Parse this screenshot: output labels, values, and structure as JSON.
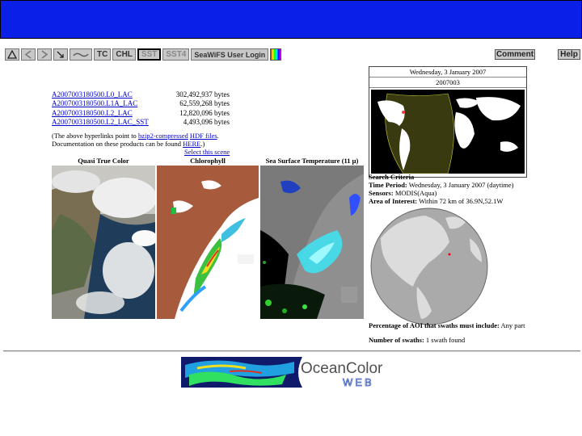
{
  "toolbar": {
    "buttons": [
      {
        "label": "TC"
      },
      {
        "label": "CHL"
      },
      {
        "label": "SST"
      },
      {
        "label": "SST4"
      },
      {
        "label": "SeaWiFS User Login"
      }
    ],
    "comment_label": "Comment",
    "help_label": "Help"
  },
  "files": [
    {
      "name": "A2007003180500.L0_LAC",
      "size": "302,492,937 bytes"
    },
    {
      "name": "A2007003180500.L1A_LAC",
      "size": "62,559,268 bytes"
    },
    {
      "name": "A2007003180500.L2_LAC",
      "size": "12,820,096 bytes"
    },
    {
      "name": "A2007003180500.L2_LAC_SST",
      "size": "4,493,096 bytes"
    }
  ],
  "note": {
    "line1_pre": "(The above hyperlinks point to ",
    "link1": "bzip2-compressed",
    "line1_mid": " ",
    "link2": "HDF files",
    "line1_post": ".",
    "line2_pre": "Documentation on these products can be found ",
    "link3": "HERE",
    "line2_post": ".)"
  },
  "select_scene": "Select this scene",
  "image_labels": {
    "true_color": "Quasi True Color",
    "chlorophyll": "Chlorophyll",
    "sst": "Sea Surface Temperature (11 μ)"
  },
  "date": {
    "long": "Wednesday, 3 January 2007",
    "short": "2007003"
  },
  "criteria": {
    "heading": "Search Criteria",
    "time_label": "Time Period:",
    "time_value": "Wednesday, 3 January 2007 (daytime)",
    "sensor_label": "Sensors:",
    "sensor_value": "MODIS(Aqua)",
    "area_label": "Area of Interest:",
    "area_value": "Within 72 km of 36.9N,52.1W"
  },
  "percentage": {
    "label": "Percentage of AOI that swaths must include:",
    "value": "Any part"
  },
  "swaths": {
    "label": "Number of swaths:",
    "value": "1 swath found"
  },
  "logo": {
    "line1": "OceanColor",
    "line2": "WEB"
  },
  "colors": {
    "banner": "#0a20e6",
    "link": "#0000cc",
    "land_chl": "#a85a3c"
  }
}
